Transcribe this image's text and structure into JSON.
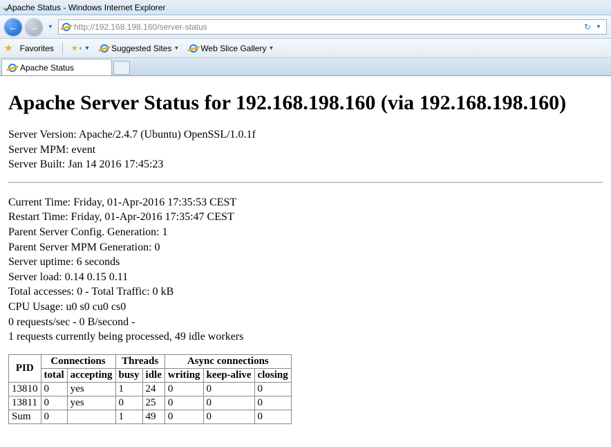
{
  "window": {
    "title": "Apache Status - Windows Internet Explorer"
  },
  "addressbar": {
    "url": "http://192.168.198.160/server-status"
  },
  "favorites": {
    "label": "Favorites",
    "suggested": "Suggested Sites",
    "webslice": "Web Slice Gallery"
  },
  "tab": {
    "label": "Apache Status"
  },
  "page": {
    "heading": "Apache Server Status for 192.168.198.160 (via 192.168.198.160)",
    "server_version": "Server Version: Apache/2.4.7 (Ubuntu) OpenSSL/1.0.1f",
    "server_mpm": "Server MPM: event",
    "server_built": "Server Built: Jan 14 2016 17:45:23",
    "current_time": "Current Time: Friday, 01-Apr-2016 17:35:53 CEST",
    "restart_time": "Restart Time: Friday, 01-Apr-2016 17:35:47 CEST",
    "parent_cfg_gen": "Parent Server Config. Generation: 1",
    "parent_mpm_gen": "Parent Server MPM Generation: 0",
    "uptime": "Server uptime: 6 seconds",
    "server_load": "Server load: 0.14 0.15 0.11",
    "total_accesses": "Total accesses: 0 - Total Traffic: 0 kB",
    "cpu_usage": "CPU Usage: u0 s0 cu0 cs0",
    "req_rate": "0 requests/sec - 0 B/second -",
    "workers": "1 requests currently being processed, 49 idle workers"
  },
  "table": {
    "h_pid": "PID",
    "h_connections": "Connections",
    "h_threads": "Threads",
    "h_async": "Async connections",
    "h_total": "total",
    "h_accepting": "accepting",
    "h_busy": "busy",
    "h_idle": "idle",
    "h_writing": "writing",
    "h_keepalive": "keep-alive",
    "h_closing": "closing",
    "rows": [
      {
        "pid": "13810",
        "total": "0",
        "accepting": "yes",
        "busy": "1",
        "idle": "24",
        "writing": "0",
        "keepalive": "0",
        "closing": "0"
      },
      {
        "pid": "13811",
        "total": "0",
        "accepting": "yes",
        "busy": "0",
        "idle": "25",
        "writing": "0",
        "keepalive": "0",
        "closing": "0"
      },
      {
        "pid": "Sum",
        "total": "0",
        "accepting": "",
        "busy": "1",
        "idle": "49",
        "writing": "0",
        "keepalive": "0",
        "closing": "0"
      }
    ]
  }
}
